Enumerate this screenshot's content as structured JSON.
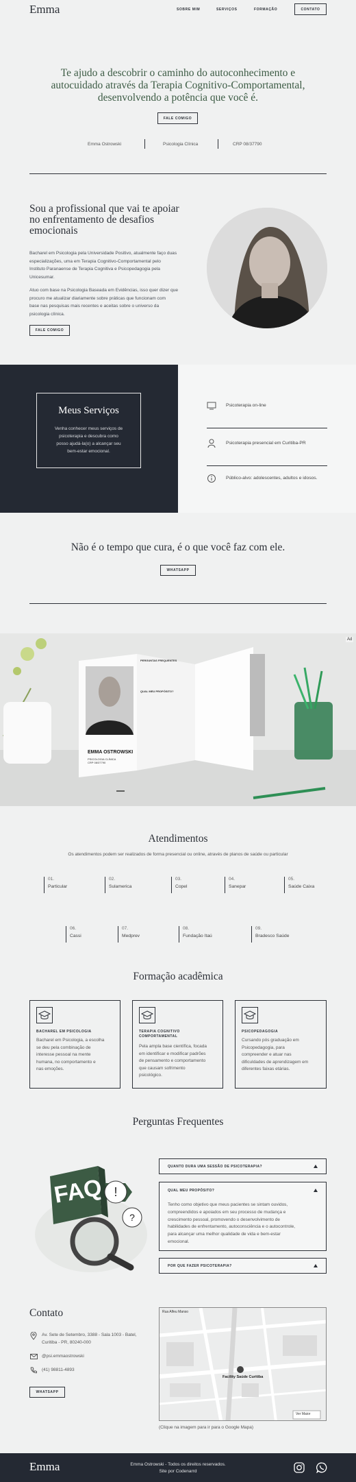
{
  "nav": {
    "logo": "Emma",
    "items": [
      "SOBRE MIM",
      "SERVIÇOS",
      "FORMAÇÃO"
    ],
    "cta": "CONTATO"
  },
  "hero": {
    "line1": "Te ajudo a descobrir o caminho do autoconhecimento e",
    "line2": "autocuidado através da Terapia Cognitivo-Comportamental,",
    "line3": "desenvolvendo a potência que você é.",
    "button": "FALE COMIGO",
    "name": "Emma Ostrowski",
    "role": "Psicologia Clínica",
    "crp": "CRP 08/37790"
  },
  "about": {
    "title1": "Sou a profissional que vai te apoiar",
    "title2": "no enfrentamento de desafios",
    "title3": "emocionais",
    "p1": [
      "Bacharel em Psicologia pela Universidade Positivo, atualmente faço duas",
      "especializações, uma em Terapia Cognitivo-Comportamental pelo",
      "Instituto Paranaense de Terapia Cognitiva e Psicopedagogia pela",
      "Unicesumar."
    ],
    "p2": [
      "Atuo com base na Psicologia Baseada em Evidências, isso quer dizer que",
      "procuro me atualizar diariamente sobre práticas que funcionam com",
      "base nas pesquisas mais recentes e aceitas sobre o universo da",
      "psicologia clínica."
    ],
    "button": "FALE COMIGO"
  },
  "services": {
    "title": "Meus Serviços",
    "desc": [
      "Venha conhecer meus serviços de",
      "psicoterapia e descubra como",
      "posso ajudá-la(o) a alcançar seu",
      "bem-estar emocional."
    ],
    "items": [
      {
        "icon": "monitor-icon",
        "label": "Psicoterapia on-line"
      },
      {
        "icon": "person-icon",
        "label": "Psicoterapia presencial em Curitiba-PR"
      },
      {
        "icon": "info-icon",
        "label": "Público-alvo: adolescentes, adultos e idosos."
      }
    ]
  },
  "quote": {
    "text": "Não é o tempo que cura, é o que você faz com ele.",
    "button": "WHATSAPP"
  },
  "brochure": {
    "name": "EMMA OSTROWSKI",
    "sub1": "PSICOLOGIA CLÍNICA",
    "sub2": "CRP 08/37790",
    "heading1": "PERGUNTAS FREQUENTES",
    "heading2": "QUAL MEU PROPÓSITO?",
    "badge": "Ad"
  },
  "atendimentos": {
    "title": "Atendimentos",
    "subtitle": "Os atendimentos podem ser realizados de forma presencial ou online, através de planos de saúde ou particular",
    "items": [
      {
        "num": "01.",
        "label": "Particular"
      },
      {
        "num": "02.",
        "label": "Sulamerica"
      },
      {
        "num": "03.",
        "label": "Copel"
      },
      {
        "num": "04.",
        "label": "Sanepar"
      },
      {
        "num": "05.",
        "label": "Saúde Caixa"
      },
      {
        "num": "06.",
        "label": "Cassi"
      },
      {
        "num": "07.",
        "label": "Medprev"
      },
      {
        "num": "08.",
        "label": "Fundação Itaú"
      },
      {
        "num": "09.",
        "label": "Bradesco Saúde"
      }
    ]
  },
  "formacao": {
    "title": "Formação acadêmica",
    "cards": [
      {
        "title": "BACHAREL EM PSICOLOGIA",
        "text": [
          "Bacharel em Psicologia, a escolha",
          "se deu pela combinação de",
          "interesse pessoal na mente",
          "humana, no comportamento e",
          "nas emoções."
        ]
      },
      {
        "title": "TERAPIA COGNITIVO COMPORTAMENTAL",
        "text": [
          "Pela ampla base científica, focada",
          "em identificar e modificar padrões",
          "de pensamento e comportamento",
          "que causam sofrimento",
          "psicológico."
        ]
      },
      {
        "title": "PSICOPEDAGOGIA",
        "text": [
          "Cursando pós graduação em",
          "Psicopedagogia, para",
          "compreender e atuar nas",
          "dificuldades de aprendizagem em",
          "diferentes faixas etárias."
        ]
      }
    ]
  },
  "faq": {
    "title": "Perguntas Frequentes",
    "image_text": "FAQ",
    "items": [
      {
        "q": "QUANTO DURA UMA SESSÃO DE PSICOTERAPIA?"
      },
      {
        "q": "QUAL MEU PROPÓSITO?",
        "a": [
          "Tenho como objetivo que meus pacientes se sintam ouvidos,",
          "compreendidos e apoiados em seu processo de mudança e",
          "crescimento pessoal, promovendo o desenvolvimento de",
          "habilidades de enfrentamento, autoconsciência e o autocontrole,",
          "para alcançar uma melhor qualidade de vida e bem-estar",
          "emocional."
        ]
      },
      {
        "q": "POR QUE FAZER PSICOTERAPIA?"
      }
    ]
  },
  "contact": {
    "title": "Contato",
    "address1": "Av. Sete de Setembro, 3388 - Sala 1003 - Batel,",
    "address2": "Curitiba - PR, 80240-000",
    "instagram": "@psi.emmaostrowski",
    "phone": "(41) 98811-4893",
    "button": "WHATSAPP",
    "map_label": "Facility Saúde Curitiba",
    "map_caption": "(Clique na imagem para ir para o Google Mapa)",
    "map_tag1": "Rua Alfeu Manso",
    "map_tag2": "Ver Maior"
  },
  "footer": {
    "logo": "Emma",
    "line1": "Emma Ostrowski - Todos os direitos reservados.",
    "line2": "Site por Codenarrd"
  },
  "colors": {
    "dark": "#242933",
    "bg": "#f0f1f1",
    "green": "#3c5b44"
  }
}
